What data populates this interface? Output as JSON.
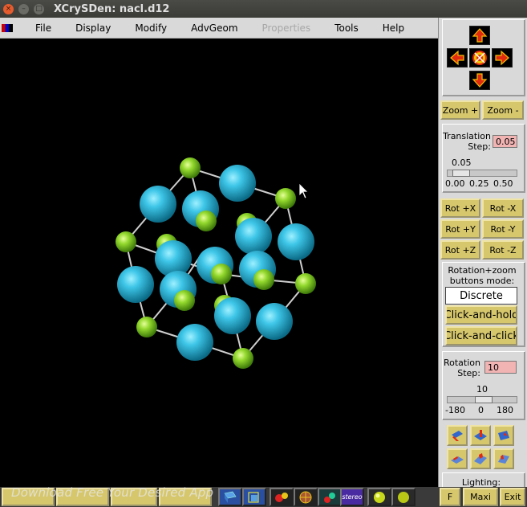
{
  "window": {
    "title": "XCrySDen: nacl.d12"
  },
  "menu": {
    "items": [
      {
        "label": "File"
      },
      {
        "label": "Display"
      },
      {
        "label": "Modify"
      },
      {
        "label": "AdvGeom"
      },
      {
        "label": "Properties",
        "disabled": true
      },
      {
        "label": "Tools"
      },
      {
        "label": "Help"
      }
    ]
  },
  "navigation": {
    "up": "arrow-up-icon",
    "down": "arrow-down-icon",
    "left": "arrow-left-icon",
    "right": "arrow-right-icon",
    "center": "reset-view-icon"
  },
  "zoom": {
    "zoom_in": "Zoom +",
    "zoom_out": "Zoom -"
  },
  "translation": {
    "label": "Translation Step:",
    "value": "0.05",
    "scale_value": "0.05",
    "ticks": [
      "0.00",
      "0.25",
      "0.50"
    ],
    "slider_fraction": 0.1
  },
  "rotation_buttons": {
    "rot_px": "Rot +X",
    "rot_mx": "Rot -X",
    "rot_py": "Rot +Y",
    "rot_my": "Rot -Y",
    "rot_pz": "Rot +Z",
    "rot_mz": "Rot -Z"
  },
  "rotation_mode": {
    "label": "Rotation+zoom buttons mode:",
    "discrete": "Discrete",
    "click_hold": "Click-and-hold",
    "click_click": "Click-and-click"
  },
  "rotation_step": {
    "label": "Rotation Step:",
    "value": "10",
    "scale_value": "10",
    "ticks": [
      "-180",
      "0",
      "180"
    ],
    "slider_fraction": 0.53
  },
  "lighting": {
    "label": "Lighting:"
  },
  "bottom": {
    "f_label": "F",
    "maxi_label": "Maxi",
    "exit_label": "Exit",
    "watermark": "Download Free Your Desired App",
    "stereo_label": "stereo"
  },
  "colors": {
    "button": "#d6c76d",
    "panel": "#d9d9d9",
    "sodium": "#27b3d6",
    "chlorine": "#8ad12a",
    "entry": "#f2b3b3"
  }
}
